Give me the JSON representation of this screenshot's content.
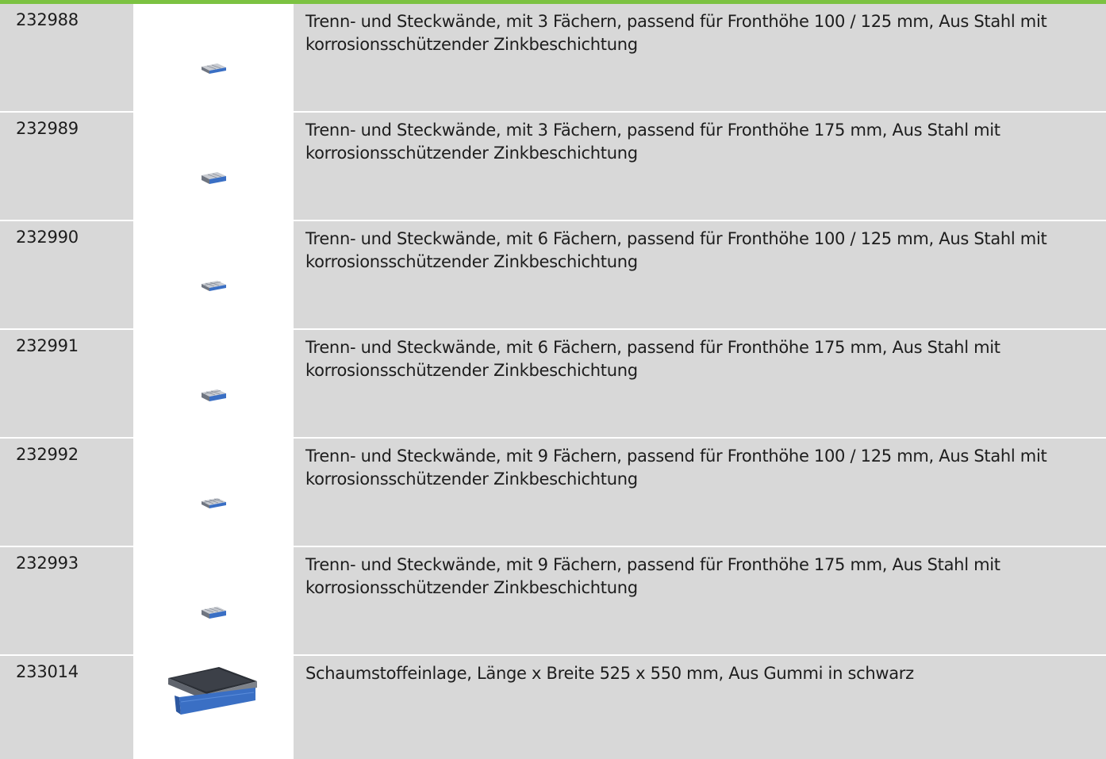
{
  "colors": {
    "accent_bar": "#7cc242",
    "cell_gray": "#d8d8d8",
    "drawer_blue": "#3a6fc4"
  },
  "rows": [
    {
      "id": "232988",
      "image_icon": "drawer-divider-thumbnail",
      "description": "Trenn- und Steckwände, mit 3 Fächern, passend für Fronthöhe 100 / 125 mm, Aus Stahl mit korrosionsschützender Zinkbeschichtung"
    },
    {
      "id": "232989",
      "image_icon": "drawer-divider-thumbnail",
      "description": "Trenn- und Steckwände, mit 3 Fächern, passend für Fronthöhe 175 mm, Aus Stahl mit korrosionsschützender Zinkbeschichtung"
    },
    {
      "id": "232990",
      "image_icon": "drawer-divider-thumbnail",
      "description": "Trenn- und Steckwände, mit 6 Fächern, passend für Fronthöhe 100 / 125 mm, Aus Stahl mit korrosionsschützender Zinkbeschichtung"
    },
    {
      "id": "232991",
      "image_icon": "drawer-divider-thumbnail",
      "description": "Trenn- und Steckwände, mit 6 Fächern, passend für Fronthöhe 175 mm, Aus Stahl mit korrosionsschützender Zinkbeschichtung"
    },
    {
      "id": "232992",
      "image_icon": "drawer-divider-thumbnail",
      "description": "Trenn- und Steckwände, mit 9 Fächern, passend für Fronthöhe 100 / 125 mm, Aus Stahl mit korrosionsschützender Zinkbeschichtung"
    },
    {
      "id": "232993",
      "image_icon": "drawer-divider-thumbnail",
      "description": "Trenn- und Steckwände, mit 9 Fächern, passend für Fronthöhe 175 mm, Aus Stahl mit korrosionsschützender Zinkbeschichtung"
    },
    {
      "id": "233014",
      "image_icon": "foam-insert-drawer-thumbnail",
      "description": "Schaumstoffeinlage, Länge x Breite 525 x 550 mm, Aus Gummi in schwarz"
    }
  ]
}
